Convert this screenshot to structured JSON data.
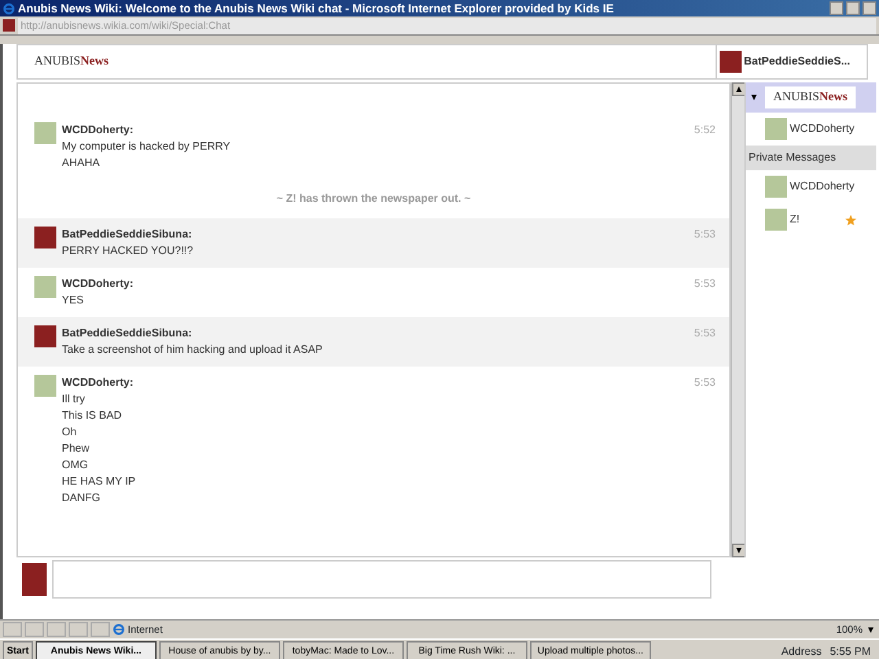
{
  "window": {
    "title": "Anubis News Wiki: Welcome to the Anubis News Wiki chat - Microsoft Internet Explorer provided by Kids IE"
  },
  "address_bar": {
    "url": "http://anubisnews.wikia.com/wiki/Special:Chat"
  },
  "header": {
    "logo": [
      "ANUBIS",
      "News"
    ],
    "current_user": "BatPeddieSeddieS..."
  },
  "chat": {
    "messages": [
      {
        "kind": "message",
        "user": "WCDDoherty:",
        "time": "5:52",
        "highlighted": false,
        "lines": [
          "My computer is hacked by PERRY",
          "AHAHA"
        ]
      },
      {
        "kind": "system",
        "text": "~ Z! has thrown the newspaper out. ~"
      },
      {
        "kind": "message",
        "user": "BatPeddieSeddieSibuna:",
        "time": "5:53",
        "highlighted": true,
        "lines": [
          "PERRY HACKED YOU?!!?"
        ]
      },
      {
        "kind": "message",
        "user": "WCDDoherty:",
        "time": "5:53",
        "highlighted": false,
        "lines": [
          "YES"
        ]
      },
      {
        "kind": "message",
        "user": "BatPeddieSeddieSibuna:",
        "time": "5:53",
        "highlighted": true,
        "lines": [
          "Take a screenshot of him hacking and upload it ASAP"
        ]
      },
      {
        "kind": "message",
        "user": "WCDDoherty:",
        "time": "5:53",
        "highlighted": false,
        "lines": [
          "Ill try",
          "This IS BAD",
          "Oh",
          "Phew",
          "OMG",
          "HE HAS MY IP",
          "DANFG"
        ]
      }
    ]
  },
  "sidebar": {
    "room": {
      "expanded": true,
      "logo": [
        "ANUBIS",
        "News"
      ],
      "users": [
        {
          "name": "WCDDoherty",
          "starred": false
        }
      ]
    },
    "private_messages": {
      "heading": "Private Messages",
      "users": [
        {
          "name": "WCDDoherty",
          "starred": false
        },
        {
          "name": "Z!",
          "starred": true
        }
      ]
    }
  },
  "status_bar": {
    "zone": "Internet",
    "zoom": "100%"
  },
  "taskbar": {
    "start": "Start",
    "tasks": [
      {
        "label": "Anubis News Wiki...",
        "selected": true
      },
      {
        "label": "House of anubis by by...",
        "selected": false
      },
      {
        "label": "tobyMac: Made to Lov...",
        "selected": false
      },
      {
        "label": "Big Time Rush Wiki: ...",
        "selected": false
      },
      {
        "label": "Upload multiple photos...",
        "selected": false
      }
    ],
    "address": "Address",
    "clock": "5:55 PM"
  }
}
